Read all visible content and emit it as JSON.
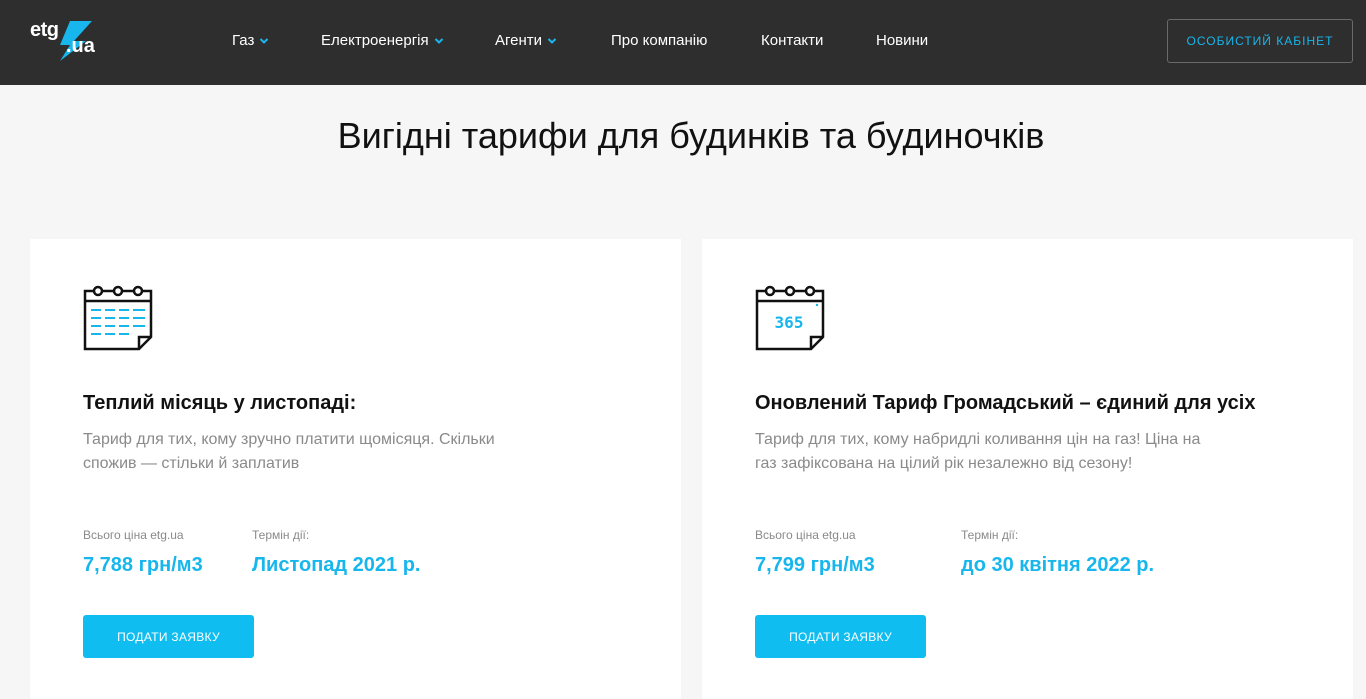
{
  "header": {
    "logo_text_main": "etg",
    "logo_text_domain": ".ua",
    "nav": [
      {
        "label": "Газ",
        "has_dropdown": true
      },
      {
        "label": "Електроенергія",
        "has_dropdown": true
      },
      {
        "label": "Агенти",
        "has_dropdown": true
      },
      {
        "label": "Про компанію",
        "has_dropdown": false
      },
      {
        "label": "Контакти",
        "has_dropdown": false
      },
      {
        "label": "Новини",
        "has_dropdown": false
      }
    ],
    "cabinet_label": "Особистий кабінет"
  },
  "main": {
    "title": "Вигідні тарифи для будинків та будиночків",
    "cards": [
      {
        "icon": "calendar-month-icon",
        "title": "Теплий місяць у листопаді:",
        "description": "Тариф для тих, кому зручно платити щомісяця. Скільки спожив — стільки й заплатив",
        "price_label": "Всього ціна etg.ua",
        "price_value": "7,788 грн/м3",
        "term_label": "Термін дії:",
        "term_value": "Листопад 2021 р.",
        "button_label": "Подати заявку"
      },
      {
        "icon": "calendar-365-icon",
        "icon_text": "365",
        "title": "Оновлений Тариф Громадський – єдиний для усіх",
        "description": "Тариф для тих, кому набридлі коливання цін на газ! Ціна на газ зафіксована на цілий рік незалежно від сезону!",
        "price_label": "Всього ціна etg.ua",
        "price_value": "7,799 грн/м3",
        "term_label": "Термін дії:",
        "term_value": "до 30 квітня 2022 р.",
        "button_label": "Подати заявку"
      }
    ]
  },
  "colors": {
    "header_bg": "#2e2e2e",
    "accent": "#17b6ec",
    "button_bg": "#10bdf0",
    "page_bg": "#f6f6f6"
  }
}
